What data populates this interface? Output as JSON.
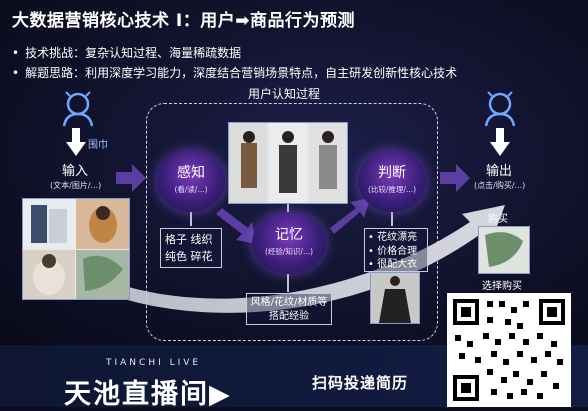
{
  "title": "大数据营销核心技术 I：用户➡商品行为预测",
  "bullets": [
    "技术挑战：复杂认知过程、海量稀疏数据",
    "解题思路：利用深度学习能力，深度结合营销场景特点，自主研发创新性核心技术"
  ],
  "process_label": "用户认知过程",
  "input": {
    "tag": "围巾",
    "label": "输入",
    "sub": "(文本/图片/...)"
  },
  "perception": {
    "label": "感知",
    "sub": "(看/读/...)"
  },
  "memory": {
    "label": "记忆",
    "sub": "(经验/知识/...)"
  },
  "judgment": {
    "label": "判断",
    "sub": "(比较/推理/...)"
  },
  "output": {
    "label": "输出",
    "sub": "(点击/购买/...)",
    "buy": "购买",
    "choose": "选择购买"
  },
  "features": [
    "格子 线织",
    "纯色 碎花"
  ],
  "reasons": [
    "• 花纹漂亮",
    "• 价格合理",
    "• 很配大衣"
  ],
  "experience": [
    "风格/花纹/材质等",
    "搭配经验"
  ],
  "banner": {
    "small": "TIANCHI LIVE",
    "big": "天池直播间▶",
    "scan": "扫码投递简历"
  },
  "colors": {
    "accent_blue": "#6fa8ff",
    "arrow_purple": "#5a3ea0",
    "circle_purple": "#7c3ab8"
  }
}
